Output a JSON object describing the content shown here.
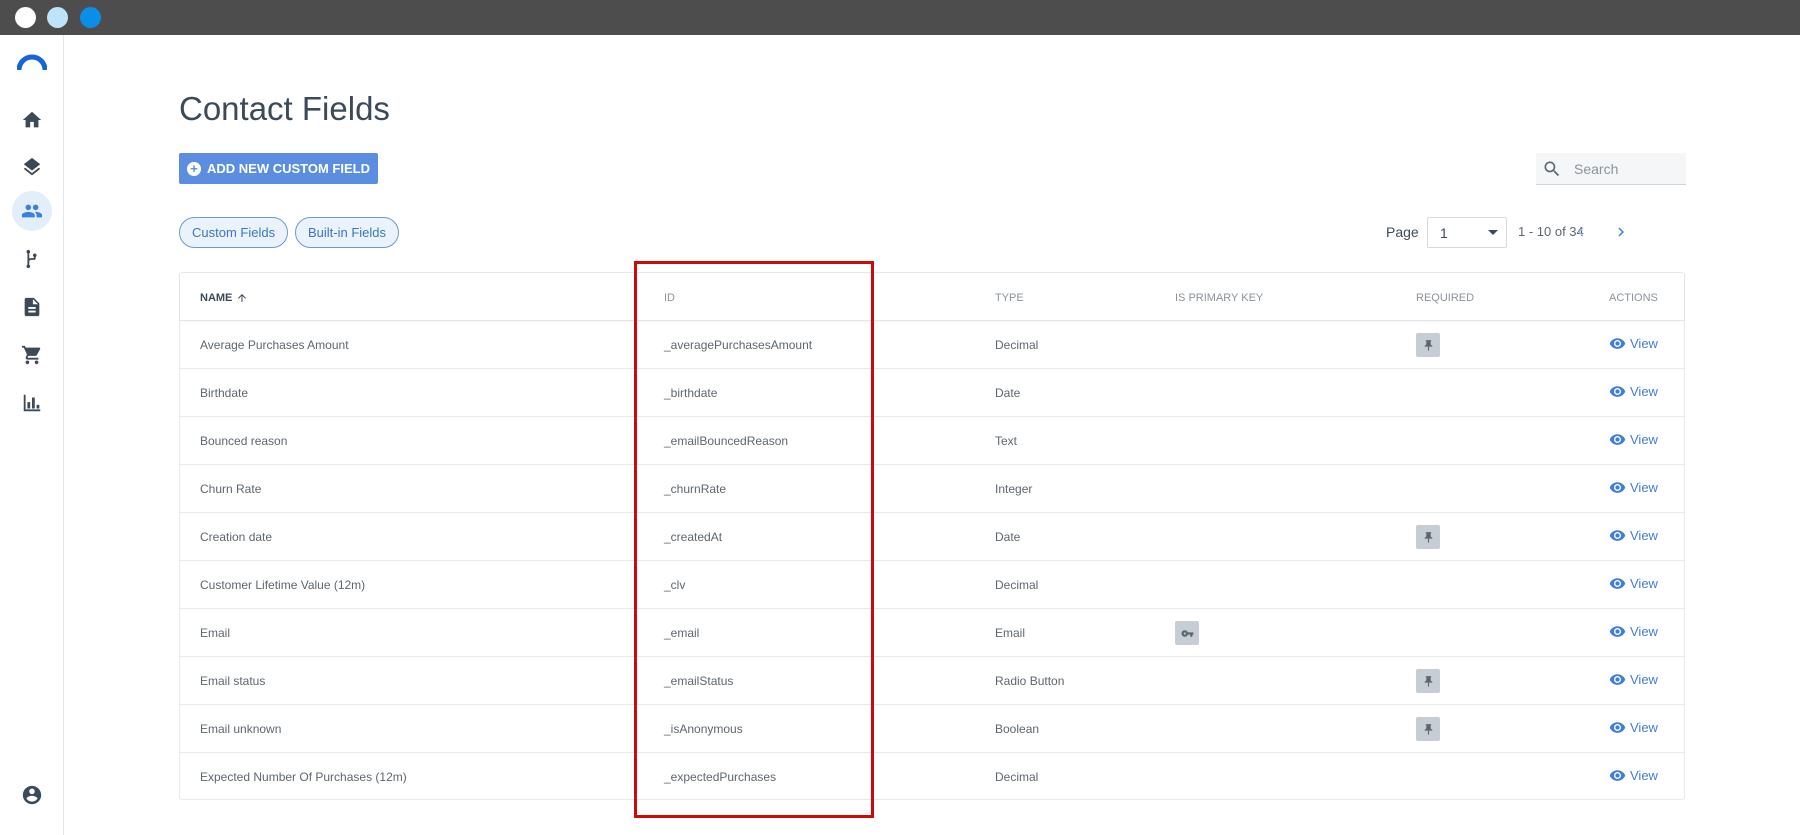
{
  "window": {
    "controls": [
      "close",
      "minimize",
      "maximize"
    ]
  },
  "sidebar": {
    "logo_icon": "brand-arc-icon",
    "items": [
      {
        "name": "home",
        "icon": "home-icon",
        "active": false
      },
      {
        "name": "layers",
        "icon": "layers-icon",
        "active": false
      },
      {
        "name": "contacts",
        "icon": "people-icon",
        "active": true
      },
      {
        "name": "flows",
        "icon": "flow-icon",
        "active": false
      },
      {
        "name": "documents",
        "icon": "document-icon",
        "active": false
      },
      {
        "name": "commerce",
        "icon": "cart-icon",
        "active": false
      },
      {
        "name": "reports",
        "icon": "bar-chart-icon",
        "active": false
      }
    ],
    "account_icon": "account-circle-icon"
  },
  "page": {
    "title": "Contact Fields",
    "add_button_label": "ADD NEW CUSTOM FIELD",
    "search_placeholder": "Search"
  },
  "filters": {
    "custom_fields": "Custom Fields",
    "builtin_fields": "Built-in Fields"
  },
  "pager": {
    "label": "Page",
    "selected_page": "1",
    "range": "1 - 10 of 34"
  },
  "table": {
    "headers": {
      "name": "NAME",
      "id": "ID",
      "type": "TYPE",
      "primary_key": "IS PRIMARY KEY",
      "required": "REQUIRED",
      "actions": "ACTIONS"
    },
    "view_label": "View",
    "rows": [
      {
        "name": "Average Purchases Amount",
        "id": "_averagePurchasesAmount",
        "type": "Decimal",
        "primary_key": false,
        "required": true
      },
      {
        "name": "Birthdate",
        "id": "_birthdate",
        "type": "Date",
        "primary_key": false,
        "required": false
      },
      {
        "name": "Bounced reason",
        "id": "_emailBouncedReason",
        "type": "Text",
        "primary_key": false,
        "required": false
      },
      {
        "name": "Churn Rate",
        "id": "_churnRate",
        "type": "Integer",
        "primary_key": false,
        "required": false
      },
      {
        "name": "Creation date",
        "id": "_createdAt",
        "type": "Date",
        "primary_key": false,
        "required": true
      },
      {
        "name": "Customer Lifetime Value (12m)",
        "id": "_clv",
        "type": "Decimal",
        "primary_key": false,
        "required": false
      },
      {
        "name": "Email",
        "id": "_email",
        "type": "Email",
        "primary_key": true,
        "required": false
      },
      {
        "name": "Email status",
        "id": "_emailStatus",
        "type": "Radio Button",
        "primary_key": false,
        "required": true
      },
      {
        "name": "Email unknown",
        "id": "_isAnonymous",
        "type": "Boolean",
        "primary_key": false,
        "required": true
      },
      {
        "name": "Expected Number Of Purchases (12m)",
        "id": "_expectedPurchases",
        "type": "Decimal",
        "primary_key": false,
        "required": false
      }
    ]
  },
  "annotation": {
    "highlight_color": "#cc0a0a",
    "target": "id-column"
  },
  "colors": {
    "accent": "#3d7fd9",
    "button": "#5b8ee0",
    "titlebar": "#4d4d4d"
  }
}
